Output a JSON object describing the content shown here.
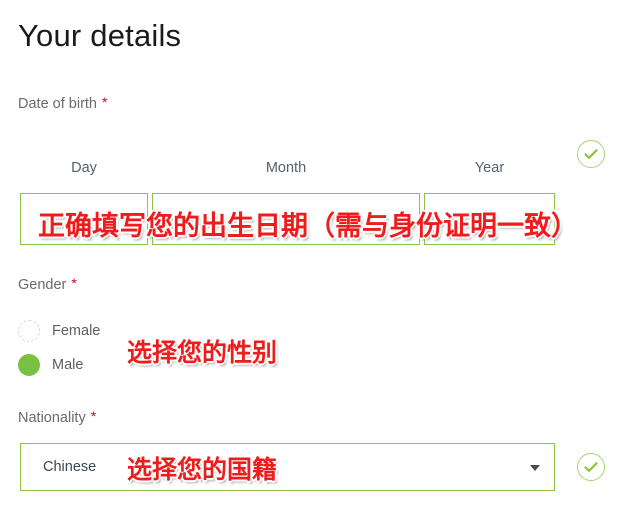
{
  "page": {
    "title": "Your details",
    "required_marker": "*"
  },
  "colors": {
    "accent_green": "#8dc63f",
    "radio_selected_green": "#7ac143",
    "check_circle_border": "#a6d471",
    "check_mark_green": "#8dc63f",
    "annotation_red": "#ee1c1c",
    "required_star_red": "#d0021b",
    "label_gray": "#6b6b6b",
    "title_black": "#1a1a1a"
  },
  "date_of_birth": {
    "label": "Date of birth",
    "required": "*",
    "columns": [
      {
        "name": "day",
        "label": "Day",
        "value": "",
        "placeholder": ""
      },
      {
        "name": "month",
        "label": "Month",
        "value": "",
        "placeholder": ""
      },
      {
        "name": "year",
        "label": "Year",
        "value": "",
        "placeholder": ""
      }
    ],
    "validation_icon": "check-circle-icon",
    "annotation": "正确填写您的出生日期（需与身份证明一致）"
  },
  "gender": {
    "label": "Gender",
    "required": "*",
    "options": [
      {
        "label": "Female",
        "selected": false
      },
      {
        "label": "Male",
        "selected": true
      }
    ],
    "annotation": "选择您的性别"
  },
  "nationality": {
    "label": "Nationality",
    "required": "*",
    "selected_value": "Chinese",
    "caret_icon": "chevron-down-icon",
    "validation_icon": "check-circle-icon",
    "annotation": "选择您的国籍"
  }
}
